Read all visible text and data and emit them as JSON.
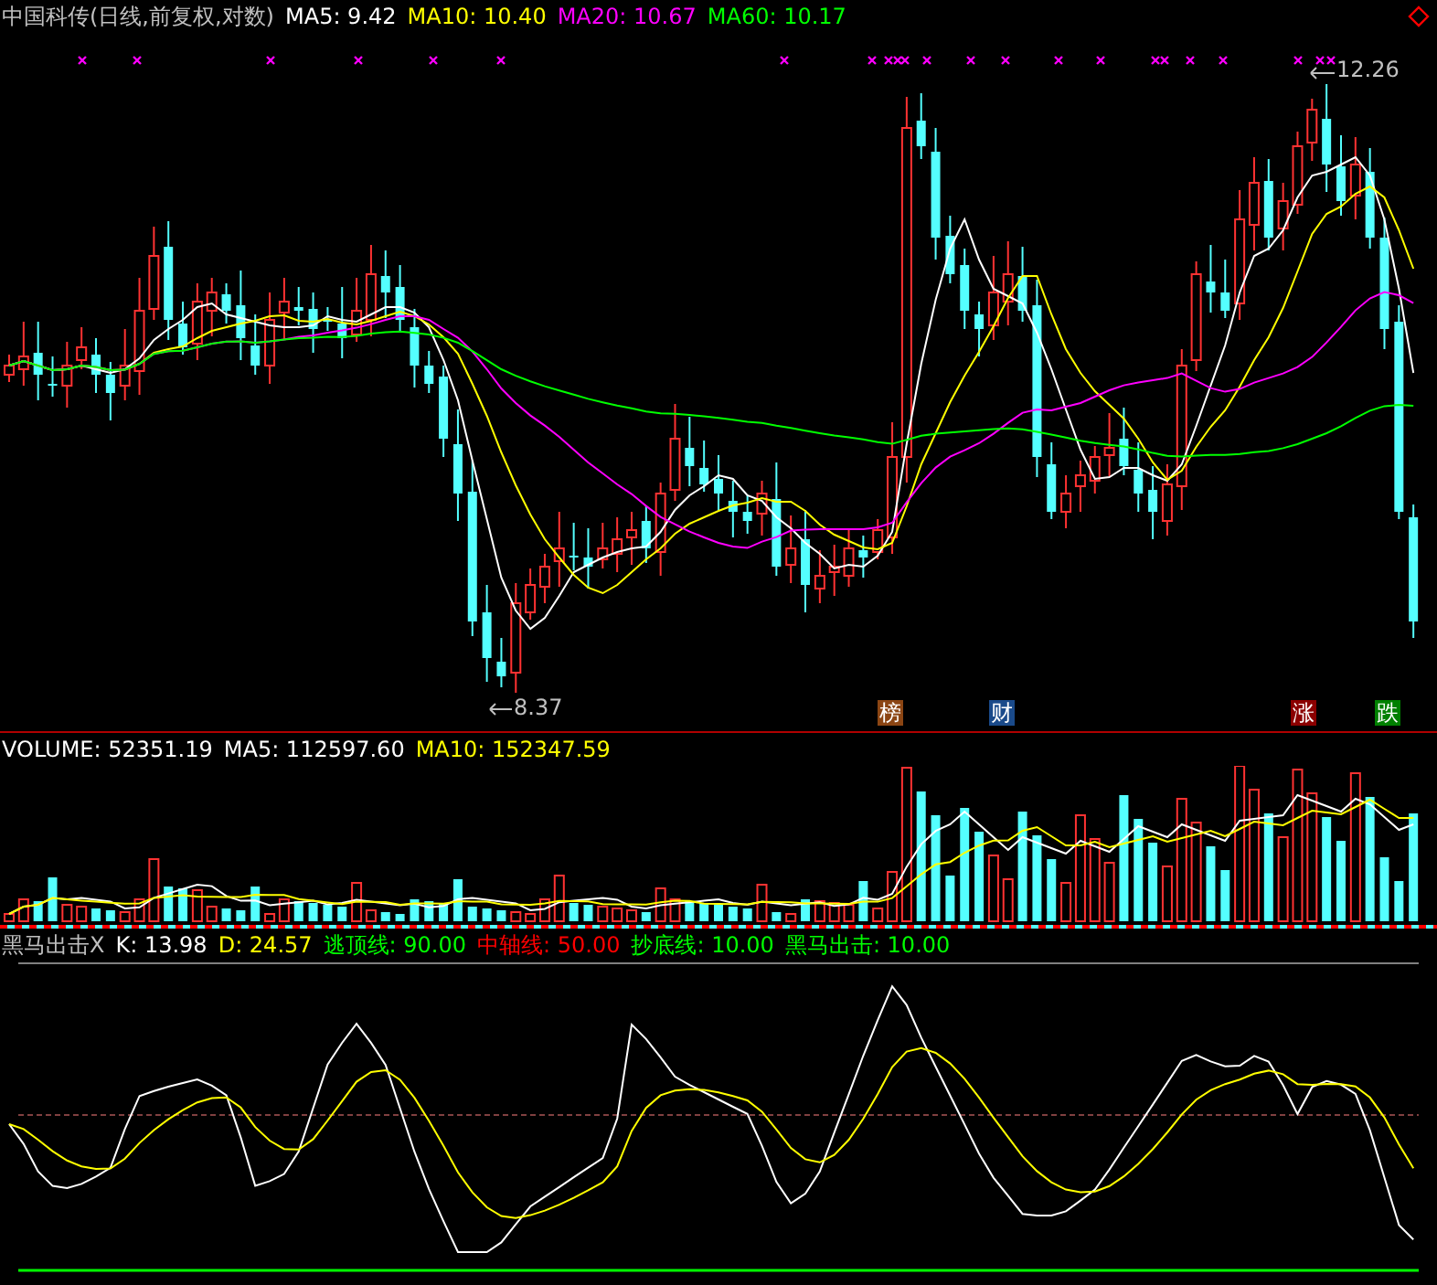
{
  "main_header": [
    {
      "text": "中国科传(日线,前复权,对数)",
      "color": "#c0c0c0"
    },
    {
      "text": "MA5: 9.42",
      "color": "#ffffff"
    },
    {
      "text": "MA10: 10.40",
      "color": "#ffff00"
    },
    {
      "text": "MA20: 10.67",
      "color": "#ff00ff"
    },
    {
      "text": "MA60: 10.17",
      "color": "#00ff00"
    }
  ],
  "high_label": "12.26",
  "low_label": "8.37",
  "event_markers": [
    {
      "label": "榜",
      "color": "#8b4513"
    },
    {
      "label": "财",
      "color": "#1a4a8a"
    },
    {
      "label": "涨",
      "color": "#8b0000"
    },
    {
      "label": "跌",
      "color": "#008000"
    }
  ],
  "volume_header": [
    {
      "text": "VOLUME: 52351.19",
      "color": "#ffffff"
    },
    {
      "text": "MA5: 112597.60",
      "color": "#ffffff"
    },
    {
      "text": "MA10: 152347.59",
      "color": "#ffff00"
    }
  ],
  "indicator_header": [
    {
      "text": "黑马出击X",
      "color": "#c0c0c0"
    },
    {
      "text": "K: 13.98",
      "color": "#ffffff"
    },
    {
      "text": "D: 24.57",
      "color": "#ffff00"
    },
    {
      "text": "逃顶线: 90.00",
      "color": "#00ff00"
    },
    {
      "text": "中轴线: 50.00",
      "color": "#ff0000"
    },
    {
      "text": "抄底线: 10.00",
      "color": "#00ff00"
    },
    {
      "text": "黑马出击: 10.00",
      "color": "#00ff00"
    }
  ]
}
